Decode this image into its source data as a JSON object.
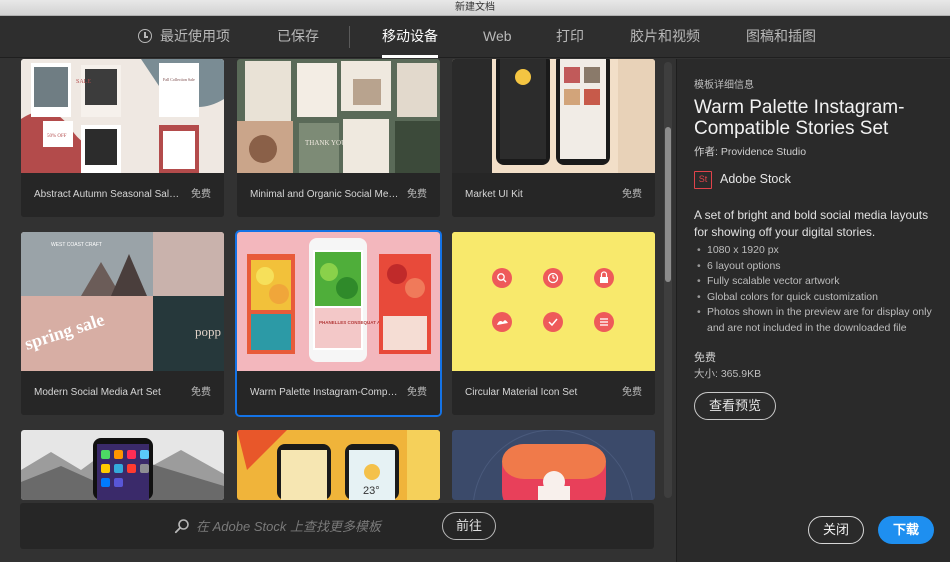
{
  "window": {
    "title": "新建文档"
  },
  "tabs": [
    {
      "label": "最近使用项"
    },
    {
      "label": "已保存"
    },
    {
      "label": "移动设备"
    },
    {
      "label": "Web"
    },
    {
      "label": "打印"
    },
    {
      "label": "胶片和视频"
    },
    {
      "label": "图稿和插图"
    }
  ],
  "cards": [
    {
      "name": "Abstract Autumn Seasonal Sales Instagram Stories",
      "price": "免费"
    },
    {
      "name": "Minimal and Organic Social Media Templates",
      "price": "免费"
    },
    {
      "name": "Market UI Kit",
      "price": "免费"
    },
    {
      "name": "Modern Social Media Art Set",
      "price": "免费"
    },
    {
      "name": "Warm Palette Instagram-Compatible Stories Set",
      "price": "免费"
    },
    {
      "name": "Circular Material Icon Set",
      "price": "免费"
    }
  ],
  "thumb_text": {
    "sale": "SALE",
    "fall": "Fall Collection Sale",
    "pct": "50% OFF",
    "thank": "THANK YOU",
    "westcoast": "WEST COAST CRAFT",
    "spring": "spring sale",
    "popup": "popp up brook",
    "phanelles": "PHANELLES CONSEQUAT ANTE",
    "temp": "23°"
  },
  "search": {
    "placeholder": "在 Adobe Stock 上查找更多模板",
    "go_label": "前往"
  },
  "details": {
    "section_label": "模板详细信息",
    "title": "Warm Palette Instagram-Compatible Stories Set",
    "author": "作者: Providence Studio",
    "stock_logo": "St",
    "stock_name": "Adobe Stock",
    "description": "A set of bright and bold social media layouts for showing off your digital stories.",
    "bullets": [
      "1080 x 1920 px",
      "6 layout options",
      "Fully scalable vector artwork",
      "Global colors for quick customization",
      "Photos shown in the preview are for display only and are not included in the downloaded file"
    ],
    "price": "免费",
    "size": "大小: 365.9KB",
    "preview_label": "查看预览",
    "close_label": "关闭",
    "download_label": "下载"
  },
  "colors": {
    "accent": "#1e8ff0",
    "selection": "#1473e6",
    "stock_brand": "#e0434a",
    "background": "#323232"
  }
}
